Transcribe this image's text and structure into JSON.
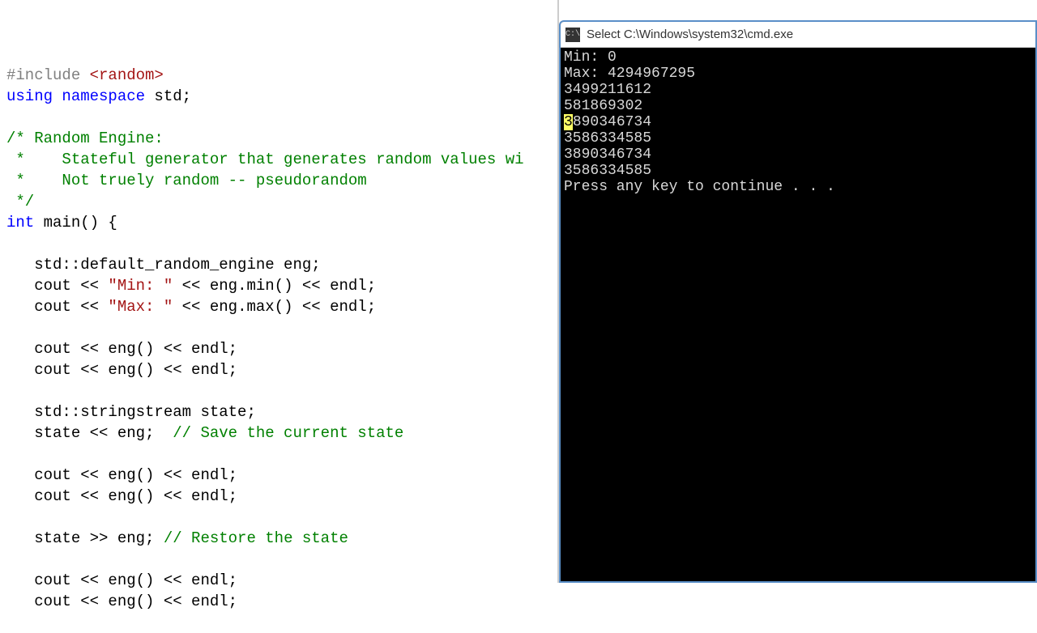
{
  "terminal": {
    "title": "Select C:\\Windows\\system32\\cmd.exe",
    "lines": {
      "l0": "Min: 0",
      "l1": "Max: 4294967295",
      "l2": "3499211612",
      "l3": "581869302",
      "l4_sel": "3",
      "l4_rest": "890346734",
      "l5": "3586334585",
      "l6": "3890346734",
      "l7": "3586334585",
      "l8": "Press any key to continue . . ."
    }
  },
  "code": {
    "include": "#include",
    "include_path": " <random>",
    "using": "using namespace",
    "std_semi": " std;",
    "comment_block_l1": "/* Random Engine:",
    "comment_block_l2": " *    Stateful generator that generates random values wi",
    "comment_block_l3": " *    Not truely random -- pseudorandom",
    "comment_block_l4": " */",
    "int_kw": "int",
    "main_sig": " main() {",
    "eng_decl": "   std::default_random_engine eng;",
    "cout_min_a": "   cout << ",
    "cout_min_str": "\"Min: \"",
    "cout_min_b": " << eng.min() << endl;",
    "cout_max_a": "   cout << ",
    "cout_max_str": "\"Max: \"",
    "cout_max_b": " << eng.max() << endl;",
    "cout_eng1": "   cout << eng() << endl;",
    "cout_eng2": "   cout << eng() << endl;",
    "state_decl": "   std::stringstream state;",
    "state_save_a": "   state << eng;  ",
    "state_save_c": "// Save the current state",
    "cout_eng3": "   cout << eng() << endl;",
    "cout_eng4": "   cout << eng() << endl;",
    "state_restore_a": "   state >> eng; ",
    "state_restore_c": "// Restore the state",
    "cout_eng5": "   cout << eng() << endl;",
    "cout_eng6": "   cout << eng() << endl;"
  }
}
